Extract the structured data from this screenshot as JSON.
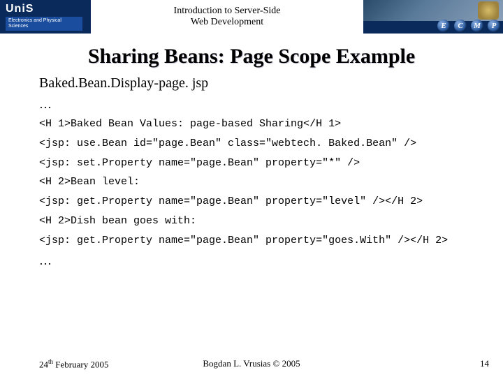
{
  "header": {
    "logo_text": "UniS",
    "dept_text": "Electronics and Physical Sciences",
    "course_line1": "Introduction to Server-Side",
    "course_line2": "Web Development",
    "circles": [
      "E",
      "C",
      "M",
      "P"
    ]
  },
  "title": "Sharing Beans: Page Scope Example",
  "subtitle": "Baked.Bean.Display-page. jsp",
  "code": {
    "l1": "<H 1>Baked Bean Values: page-based Sharing</H 1>",
    "l2": "<jsp: use.Bean id=\"page.Bean\" class=\"webtech. Baked.Bean\" />",
    "l3": "<jsp: set.Property name=\"page.Bean\" property=\"*\" />",
    "l4": "<H 2>Bean level:",
    "l5": "<jsp: get.Property name=\"page.Bean\" property=\"level\" /></H 2>",
    "l6": "<H 2>Dish bean goes with:",
    "l7": "<jsp: get.Property name=\"page.Bean\" property=\"goes.With\" /></H 2>"
  },
  "ellipsis": "…",
  "footer": {
    "date_day": "24",
    "date_suffix": "th",
    "date_rest": " February 2005",
    "author": "Bogdan L. Vrusias © 2005",
    "page": "14"
  }
}
